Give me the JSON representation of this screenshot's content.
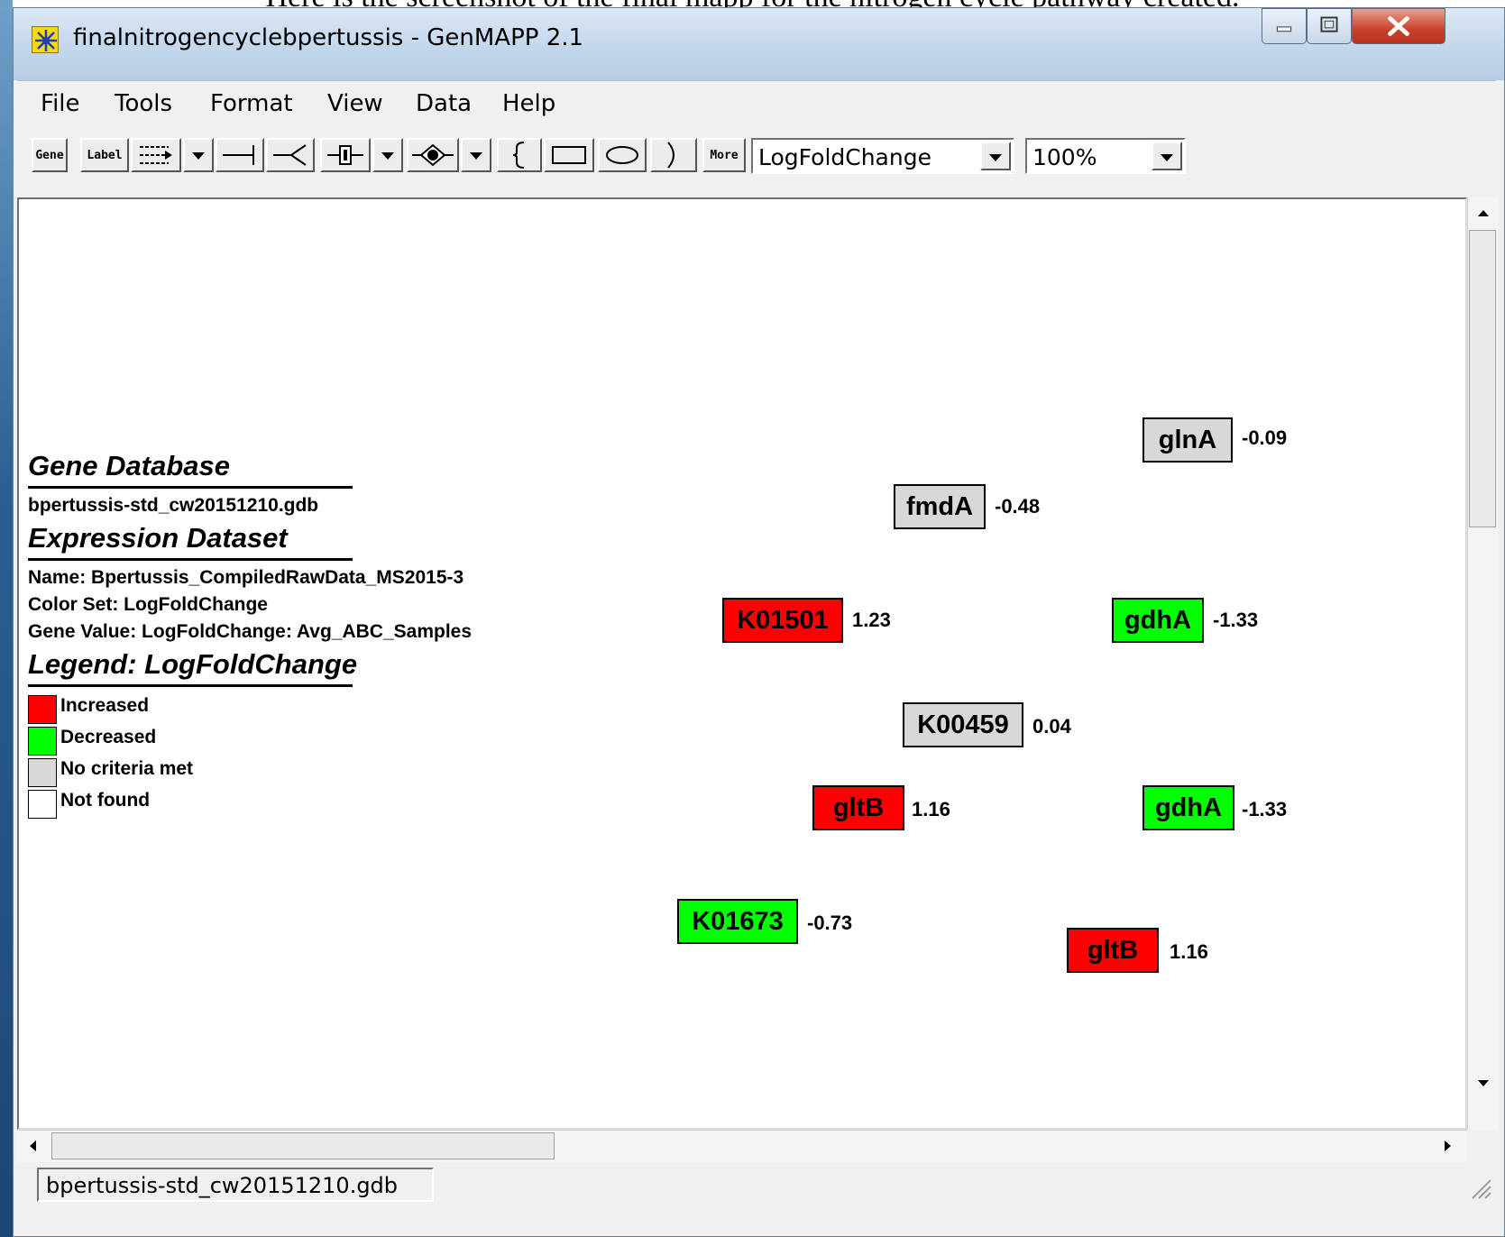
{
  "caption": "Here is the screenshot of the final mapp for the nitrogen cycle pathway created.",
  "window": {
    "title": "finalnitrogencyclebpertussis - GenMAPP 2.1",
    "controls": [
      "minimize-icon",
      "maximize-icon",
      "close-icon"
    ]
  },
  "menu": [
    "File",
    "Tools",
    "Format",
    "View",
    "Data",
    "Help"
  ],
  "toolbar": {
    "gene_label": "Gene",
    "label_label": "Label",
    "more_label": "More",
    "colorset_value": "LogFoldChange",
    "zoom_value": "100%",
    "icons": [
      "arrow-line-icon",
      "dropdown-arrow-icon",
      "inhibit-line-icon",
      "receptor-line-icon",
      "channel-icon",
      "dropdown-arrow-icon",
      "protein-shape-icon",
      "dropdown-arrow-icon",
      "brace-icon",
      "rectangle-icon",
      "oval-icon",
      "arc-icon"
    ]
  },
  "legend": {
    "gene_database_heading": "Gene Database",
    "gene_database_value": "bpertussis-std_cw20151210.gdb",
    "expression_heading": "Expression Dataset",
    "expression_name": "Name: Bpertussis_CompiledRawData_MS2015-3",
    "color_set": "Color Set: LogFoldChange",
    "gene_value": "Gene Value: LogFoldChange: Avg_ABC_Samples",
    "legend_heading": "Legend: LogFoldChange",
    "items": [
      {
        "label": "Increased",
        "color": "#ff0000"
      },
      {
        "label": "Decreased",
        "color": "#00ff00"
      },
      {
        "label": "No criteria met",
        "color": "#d8d8d8"
      },
      {
        "label": "Not found",
        "color": "#ffffff"
      }
    ]
  },
  "genes": [
    {
      "name": "glnA",
      "value": "-0.09",
      "status": "No criteria met",
      "color": "#d8d8d8"
    },
    {
      "name": "fmdA",
      "value": "-0.48",
      "status": "No criteria met",
      "color": "#d8d8d8"
    },
    {
      "name": "K01501",
      "value": "1.23",
      "status": "Increased",
      "color": "#ff0000"
    },
    {
      "name": "gdhA",
      "value": "-1.33",
      "status": "Decreased",
      "color": "#00ff00"
    },
    {
      "name": "K00459",
      "value": "0.04",
      "status": "No criteria met",
      "color": "#d8d8d8"
    },
    {
      "name": "gltB",
      "value": "1.16",
      "status": "Increased",
      "color": "#ff0000"
    },
    {
      "name": "gdhA",
      "value": "-1.33",
      "status": "Decreased",
      "color": "#00ff00"
    },
    {
      "name": "K01673",
      "value": "-0.73",
      "status": "Decreased",
      "color": "#00ff00"
    },
    {
      "name": "gltB",
      "value": "1.16",
      "status": "Increased",
      "color": "#ff0000"
    }
  ],
  "statusbar": {
    "database": "bpertussis-std_cw20151210.gdb"
  }
}
